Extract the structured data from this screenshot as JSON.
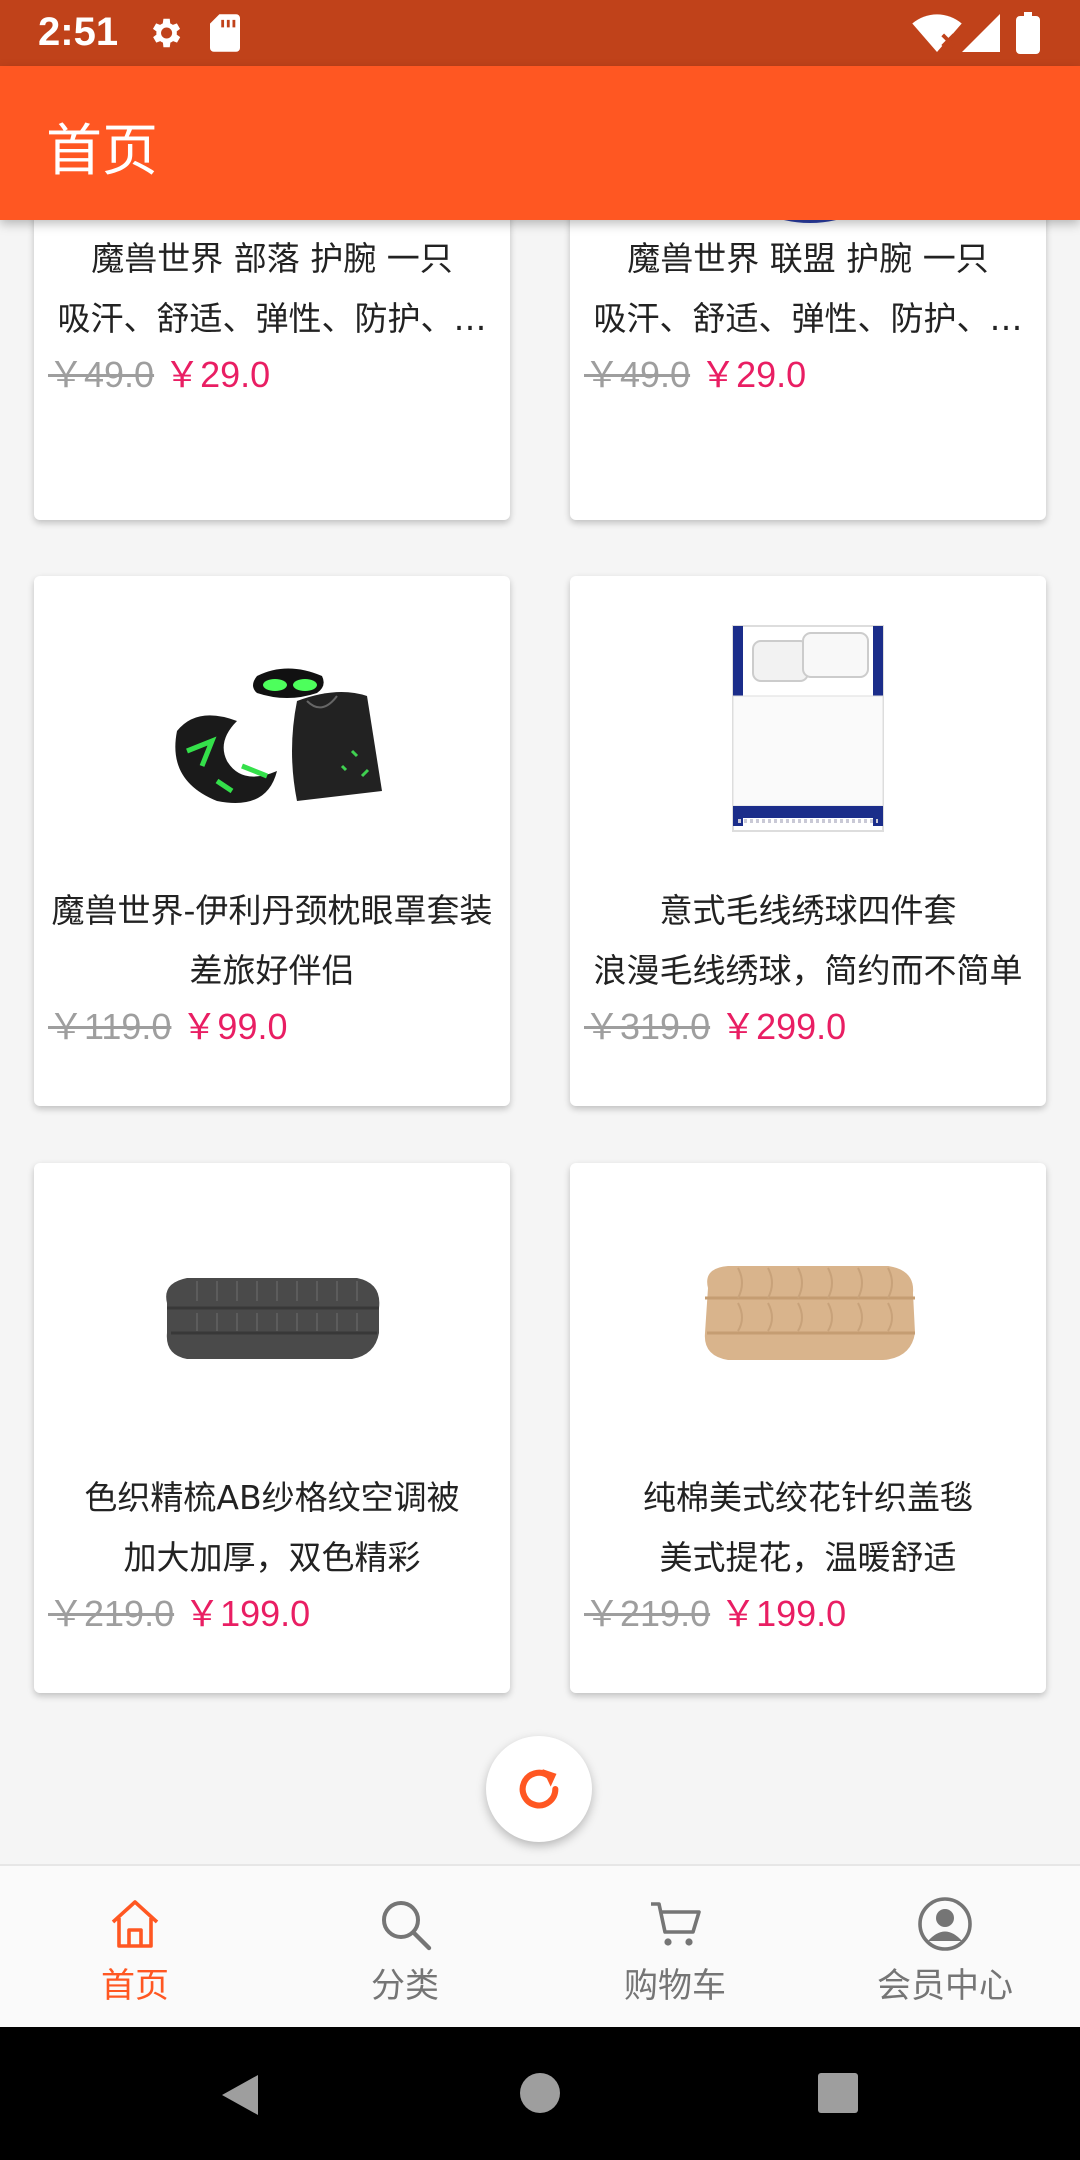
{
  "status_bar": {
    "time": "2:51",
    "icons": [
      "settings-icon",
      "sd-card-icon",
      "wifi-icon",
      "signal-icon",
      "battery-icon"
    ]
  },
  "app_bar": {
    "title": "首页"
  },
  "products": [
    {
      "name": "魔兽世界 部落 护腕 一只",
      "desc": "吸汗、舒适、弹性、防护、…",
      "old_price": "￥49.0",
      "price": "￥29.0"
    },
    {
      "name": "魔兽世界 联盟 护腕 一只",
      "desc": "吸汗、舒适、弹性、防护、…",
      "old_price": "￥49.0",
      "price": "￥29.0"
    },
    {
      "name": "魔兽世界-伊利丹颈枕眼罩套装",
      "desc": "差旅好伴侣",
      "old_price": "￥119.0",
      "price": "￥99.0"
    },
    {
      "name": "意式毛线绣球四件套",
      "desc": "浪漫毛线绣球，简约而不简单",
      "old_price": "￥319.0",
      "price": "￥299.0"
    },
    {
      "name": "色织精梳AB纱格纹空调被",
      "desc": "加大加厚，双色精彩",
      "old_price": "￥219.0",
      "price": "￥199.0"
    },
    {
      "name": "纯棉美式绞花针织盖毯",
      "desc": "美式提花，温暖舒适",
      "old_price": "￥219.0",
      "price": "￥199.0"
    }
  ],
  "refresh_button": {
    "icon": "refresh-icon"
  },
  "bottom_nav": [
    {
      "label": "首页",
      "icon": "home-icon",
      "active": true
    },
    {
      "label": "分类",
      "icon": "search-icon",
      "active": false
    },
    {
      "label": "购物车",
      "icon": "cart-icon",
      "active": false
    },
    {
      "label": "会员中心",
      "icon": "account-icon",
      "active": false
    }
  ],
  "colors": {
    "primary": "#ff5722",
    "status_bar": "#c0421a",
    "price": "#e91e63",
    "old_price": "#9e9e9e"
  },
  "system_nav": [
    "back-icon",
    "home-circle-icon",
    "recents-icon"
  ]
}
